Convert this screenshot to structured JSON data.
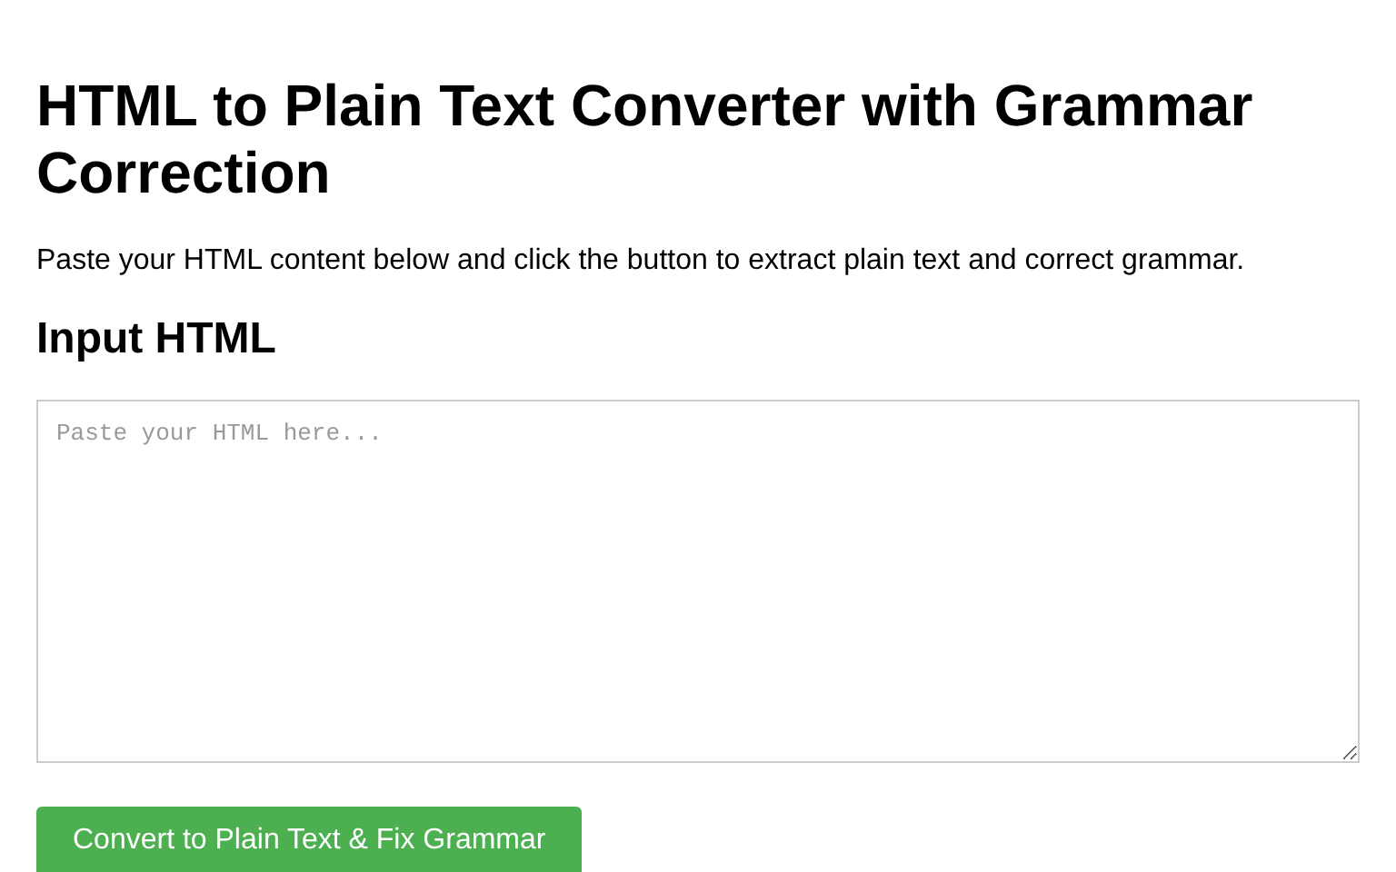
{
  "title": "HTML to Plain Text Converter with Grammar Correction",
  "description": "Paste your HTML content below and click the button to extract plain text and correct grammar.",
  "input_section": {
    "heading": "Input HTML",
    "placeholder": "Paste your HTML here..."
  },
  "button": {
    "label": "Convert to Plain Text & Fix Grammar"
  }
}
